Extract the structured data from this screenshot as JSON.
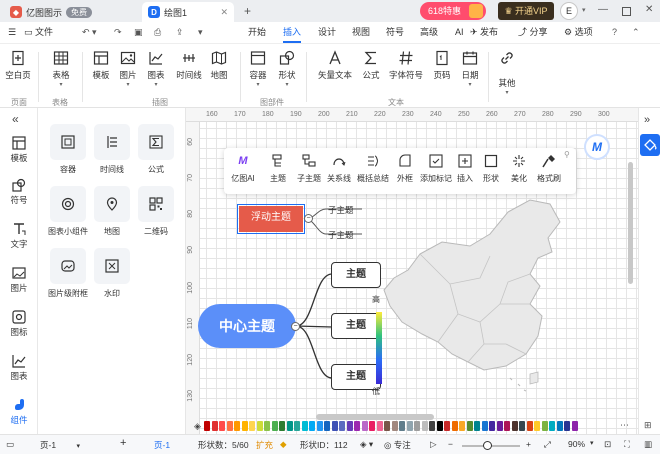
{
  "titlebar": {
    "app_tab": "亿图图示",
    "app_badge": "免费",
    "doc_tab": "绘图1",
    "promo_label": "618特惠",
    "vip_label": "开通VIP",
    "avatar_letter": "E"
  },
  "menubar": {
    "file": "文件",
    "items": [
      "开始",
      "插入",
      "设计",
      "视图",
      "符号",
      "高级",
      "AI"
    ],
    "active": "插入",
    "publish": "发布",
    "share": "分享",
    "options": "选项"
  },
  "ribbon": {
    "buttons": [
      "空白页",
      "表格",
      "模板",
      "图片",
      "图表",
      "时间线",
      "地图",
      "容器",
      "形状",
      "矢量文本",
      "公式",
      "字体符号",
      "页码",
      "日期",
      "其他"
    ],
    "groups": [
      "页面",
      "表格",
      "插图",
      "图部件",
      "文本"
    ]
  },
  "leftbar": {
    "items": [
      "模板",
      "符号",
      "文字",
      "图片",
      "图标",
      "图表",
      "组件"
    ],
    "active": "组件"
  },
  "library": {
    "items": [
      "容器",
      "时间线",
      "公式",
      "图表小组件",
      "地图",
      "二维码",
      "图片级附框",
      "水印"
    ]
  },
  "rulers": {
    "h_ticks": [
      "160",
      "170",
      "180",
      "190",
      "200",
      "210",
      "220",
      "230",
      "240",
      "250",
      "260",
      "270",
      "280",
      "290",
      "300"
    ],
    "v_ticks": [
      "60",
      "70",
      "80",
      "90",
      "100",
      "110",
      "120",
      "130"
    ]
  },
  "floating_toolbar": {
    "items": [
      "亿图AI",
      "主题",
      "子主题",
      "关系线",
      "概括总结",
      "外框",
      "添加标记",
      "插入",
      "形状",
      "美化",
      "格式刷"
    ]
  },
  "mindmap": {
    "center": "中心主题",
    "floating": "浮动主题",
    "sub_topics": [
      "子主题",
      "子主题"
    ],
    "topics": [
      "主题",
      "主题",
      "主题"
    ]
  },
  "legend": {
    "high": "高",
    "low": "低"
  },
  "statusbar": {
    "page_selector": "页-1",
    "page_tab": "页-1",
    "shape_count": "形状数：5/60",
    "expand": "扩充",
    "shape_id": "形状ID：112",
    "focus": "专注",
    "zoom": "90%"
  },
  "colors": {
    "accent": "#1e6ef2",
    "center_topic": "#5b8ff9",
    "floating_topic": "#e55b4a",
    "promo": "#ff4d6d",
    "vip": "#8a6a2e"
  },
  "palette": [
    "#c00000",
    "#e03030",
    "#ff4b4b",
    "#ff7043",
    "#ff9800",
    "#ffb300",
    "#ffd54f",
    "#cddc39",
    "#8bc34a",
    "#4caf50",
    "#2e7d32",
    "#009688",
    "#26a69a",
    "#00bcd4",
    "#03a9f4",
    "#2196f3",
    "#1565c0",
    "#3f51b5",
    "#5c6bc0",
    "#673ab7",
    "#9c27b0",
    "#ba68c8",
    "#e91e63",
    "#f06292",
    "#795548",
    "#a1887f",
    "#607d8b",
    "#90a4ae",
    "#9e9e9e",
    "#bdbdbd",
    "#424242",
    "#000000",
    "#c62828",
    "#ef6c00",
    "#f9a825",
    "#558b2f",
    "#00838f",
    "#1976d2",
    "#4527a0",
    "#6a1b9a",
    "#ad1457",
    "#4e342e",
    "#37474f",
    "#d84315",
    "#ffca28",
    "#7cb342",
    "#00acc1",
    "#0277bd",
    "#283593",
    "#8e24aa"
  ]
}
